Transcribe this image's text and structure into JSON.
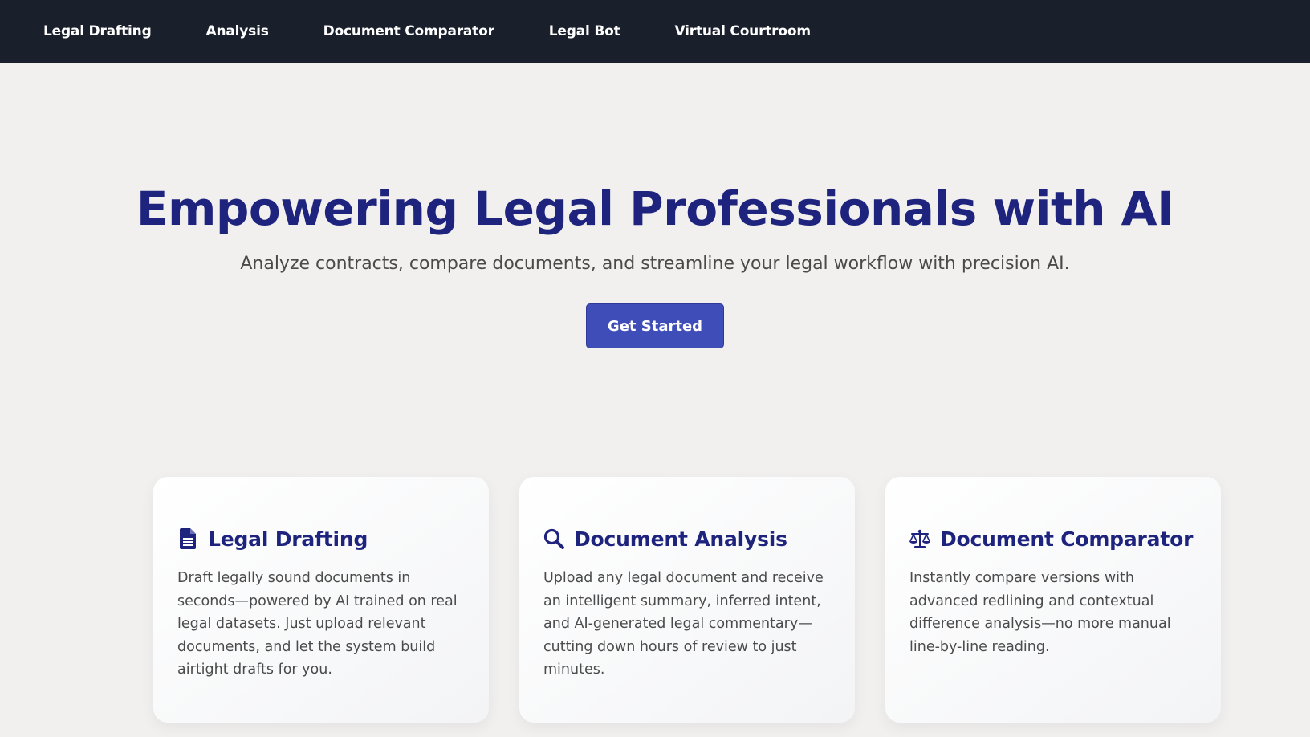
{
  "nav": {
    "items": [
      {
        "label": "Legal Drafting"
      },
      {
        "label": "Analysis"
      },
      {
        "label": "Document Comparator"
      },
      {
        "label": "Legal Bot"
      },
      {
        "label": "Virtual Courtroom"
      }
    ]
  },
  "hero": {
    "title": "Empowering Legal Professionals with AI",
    "subtitle": "Analyze contracts, compare documents, and streamline your legal workflow with precision AI.",
    "cta_label": "Get Started"
  },
  "features": [
    {
      "icon": "document-icon",
      "title": "Legal Drafting",
      "description": "Draft legally sound documents in seconds—powered by AI trained on real legal datasets. Just upload relevant documents, and let the system build airtight drafts for you."
    },
    {
      "icon": "search-icon",
      "title": "Document Analysis",
      "description": "Upload any legal document and receive an intelligent summary, inferred intent, and AI-generated legal commentary—cutting down hours of review to just minutes."
    },
    {
      "icon": "scales-icon",
      "title": "Document Comparator",
      "description": "Instantly compare versions with advanced redlining and contextual difference analysis—no more manual line-by-line reading."
    }
  ],
  "colors": {
    "nav_bg": "#1a1f2c",
    "page_bg": "#f1f0ef",
    "heading": "#1e237e",
    "accent": "#3f4db8"
  }
}
